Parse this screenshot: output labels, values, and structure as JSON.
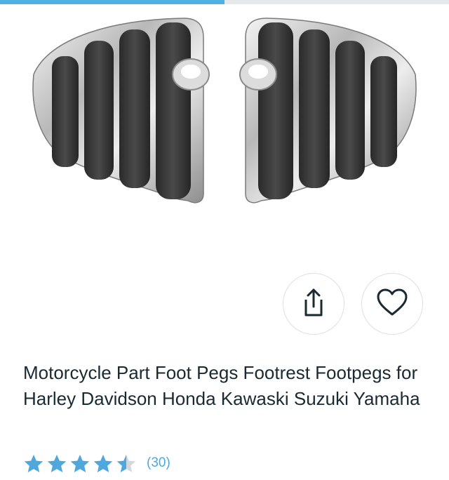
{
  "progress": {
    "fraction": 0.5
  },
  "product": {
    "image_alt": "Chrome motorcycle foot pegs with black rubber inserts",
    "title": "Motorcycle Part Foot Pegs Footrest Footpegs for Harley Davidson Honda Kawaski Suzuki Yamaha",
    "rating": {
      "value": 4.5,
      "max": 5,
      "count_label": "(30)"
    }
  },
  "actions": {
    "share_icon": "share-icon",
    "favorite_icon": "heart-icon"
  },
  "colors": {
    "accent": "#4fa8dd",
    "progress": "#4fb0e3",
    "star": "#4fa8dd",
    "star_empty": "#d4d8dc",
    "text": "#192a32"
  }
}
